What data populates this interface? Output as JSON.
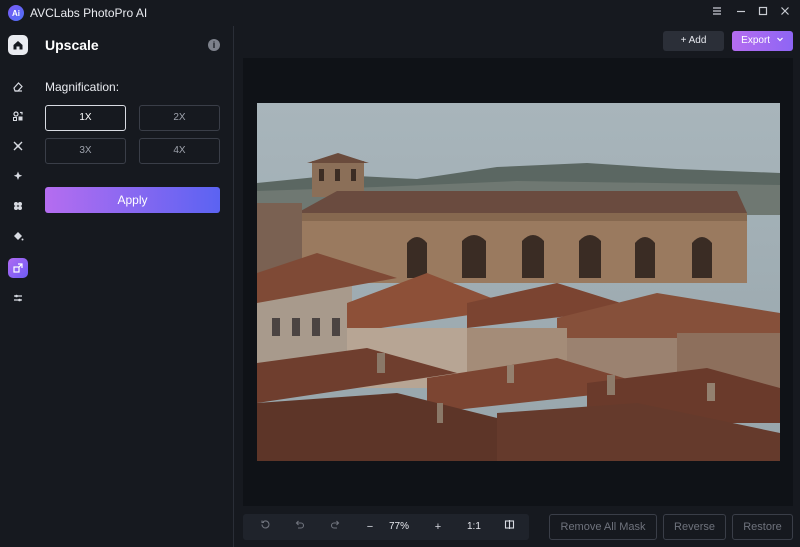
{
  "app": {
    "title": "AVCLabs PhotoPro AI",
    "logo_text": "Ai"
  },
  "window": {
    "menu_icon": "menu-icon",
    "minimize_icon": "minimize-icon",
    "maximize_icon": "maximize-icon",
    "close_icon": "close-icon"
  },
  "rail": {
    "items": [
      {
        "name": "home-icon"
      },
      {
        "name": "eraser-icon"
      },
      {
        "name": "replace-icon"
      },
      {
        "name": "crop-icon"
      },
      {
        "name": "enhance-icon"
      },
      {
        "name": "effects-icon"
      },
      {
        "name": "fill-icon"
      },
      {
        "name": "upscale-icon",
        "active": true
      },
      {
        "name": "adjust-icon"
      }
    ]
  },
  "panel": {
    "title": "Upscale",
    "info_glyph": "i",
    "magnification_label": "Magnification:",
    "options": [
      "1X",
      "2X",
      "3X",
      "4X"
    ],
    "selected": "1X",
    "apply_label": "Apply"
  },
  "header": {
    "add_label": "+ Add",
    "export_label": "Export"
  },
  "zoom": {
    "value": "77%",
    "ratio": "1:1",
    "minus": "−",
    "plus": "+"
  },
  "actions": {
    "remove_all_mask": "Remove All Mask",
    "reverse": "Reverse",
    "restore": "Restore"
  },
  "colors": {
    "accent_start": "#b56df0",
    "accent_end": "#5b63f2",
    "bg": "#16191f",
    "canvas": "#0f1217"
  }
}
